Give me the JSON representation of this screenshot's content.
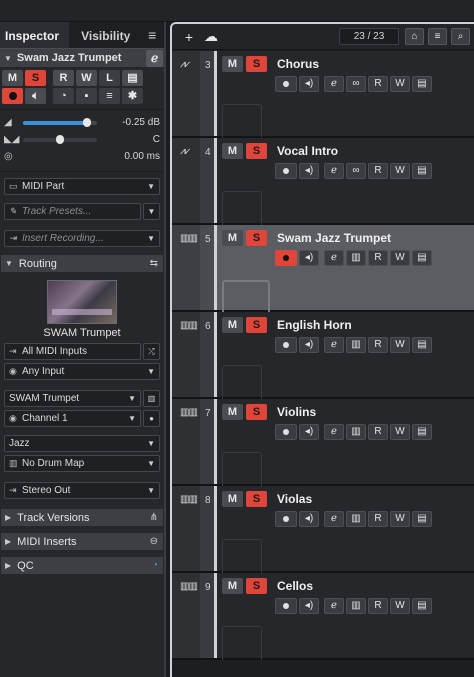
{
  "inspector": {
    "tabs": {
      "inspector": "Inspector",
      "visibility": "Visibility",
      "menu": "≡"
    },
    "track_name": "Swam Jazz Trumpet",
    "buttons": {
      "m": "M",
      "s": "S",
      "r": "R",
      "w": "W",
      "l": "L"
    },
    "volume": {
      "value": "-0.25 dB",
      "level_fraction": 0.86
    },
    "pan": {
      "value": "C",
      "level_fraction": 0.5
    },
    "delay": {
      "value": "0.00 ms"
    },
    "midi_part": "MIDI Part",
    "track_presets": "Track Presets...",
    "insert_recording": "Insert Recording...",
    "routing": {
      "title": "Routing",
      "instrument_name": "SWAM Trumpet",
      "input": "All MIDI Inputs",
      "input_port": "Any Input",
      "output": "SWAM Trumpet",
      "channel": "Channel 1",
      "program": "Jazz",
      "drum_map": "No Drum Map",
      "audio_output": "Stereo Out"
    },
    "sections": {
      "track_versions": "Track Versions",
      "midi_inserts": "MIDI Inserts",
      "qc": "QC"
    }
  },
  "toolbar": {
    "track_count": "23 / 23"
  },
  "tracks": [
    {
      "number": "3",
      "name": "Chorus",
      "type": "audio",
      "m": "M",
      "s": "S",
      "r": "R",
      "w": "W",
      "selected": false
    },
    {
      "number": "4",
      "name": "Vocal Intro",
      "type": "audio",
      "m": "M",
      "s": "S",
      "r": "R",
      "w": "W",
      "selected": false
    },
    {
      "number": "5",
      "name": "Swam Jazz Trumpet",
      "type": "instrument",
      "m": "M",
      "s": "S",
      "r": "R",
      "w": "W",
      "selected": true
    },
    {
      "number": "6",
      "name": "English Horn",
      "type": "instrument",
      "m": "M",
      "s": "S",
      "r": "R",
      "w": "W",
      "selected": false
    },
    {
      "number": "7",
      "name": "Violins",
      "type": "instrument",
      "m": "M",
      "s": "S",
      "r": "R",
      "w": "W",
      "selected": false
    },
    {
      "number": "8",
      "name": "Violas",
      "type": "instrument",
      "m": "M",
      "s": "S",
      "r": "R",
      "w": "W",
      "selected": false
    },
    {
      "number": "9",
      "name": "Cellos",
      "type": "instrument",
      "m": "M",
      "s": "S",
      "r": "R",
      "w": "W",
      "selected": false
    }
  ],
  "colors": {
    "solo_red": "#e0453a",
    "volume_blue": "#3d8fd6",
    "qc_blue": "#3aa0f0"
  }
}
